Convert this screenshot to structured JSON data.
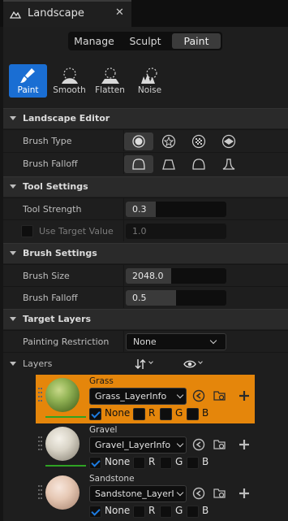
{
  "window": {
    "title": "Landscape",
    "close": "✕"
  },
  "modes": [
    "Manage",
    "Sculpt",
    "Paint"
  ],
  "active_mode": "Paint",
  "tools": [
    {
      "label": "Paint",
      "icon": "paint-brush-icon",
      "active": true
    },
    {
      "label": "Smooth",
      "icon": "smooth-icon",
      "active": false
    },
    {
      "label": "Flatten",
      "icon": "flatten-icon",
      "active": false
    },
    {
      "label": "Noise",
      "icon": "noise-icon",
      "active": false
    }
  ],
  "landscape_editor": {
    "title": "Landscape Editor",
    "brush_type_label": "Brush Type",
    "brush_falloff_label": "Brush Falloff"
  },
  "tool_settings": {
    "title": "Tool Settings",
    "tool_strength_label": "Tool Strength",
    "tool_strength_value": "0.3",
    "tool_strength_fill": 0.3,
    "use_target_label": "Use Target Value",
    "use_target_value": "1.0"
  },
  "brush_settings": {
    "title": "Brush Settings",
    "brush_size_label": "Brush Size",
    "brush_size_value": "2048.0",
    "brush_size_fill": 0.45,
    "brush_falloff_label": "Brush Falloff",
    "brush_falloff_value": "0.5",
    "brush_falloff_fill": 0.5
  },
  "target_layers": {
    "title": "Target Layers",
    "painting_restriction_label": "Painting Restriction",
    "painting_restriction_value": "None",
    "layers_label": "Layers"
  },
  "layers": [
    {
      "name": "Grass",
      "info": "Grass_LayerInfo",
      "selected": true,
      "channels": [
        "None",
        "R",
        "G",
        "B"
      ]
    },
    {
      "name": "Gravel",
      "info": "Gravel_LayerInfo",
      "selected": false,
      "channels": [
        "None",
        "R",
        "G",
        "B"
      ]
    },
    {
      "name": "Sandstone",
      "info": "Sandstone_LayerInfo",
      "selected": false,
      "channels": [
        "None",
        "R",
        "G",
        "B"
      ]
    }
  ],
  "colors": {
    "accent": "#1a6ed3",
    "selected_layer": "#e5860b",
    "thumb_bar": "#2fa324"
  }
}
